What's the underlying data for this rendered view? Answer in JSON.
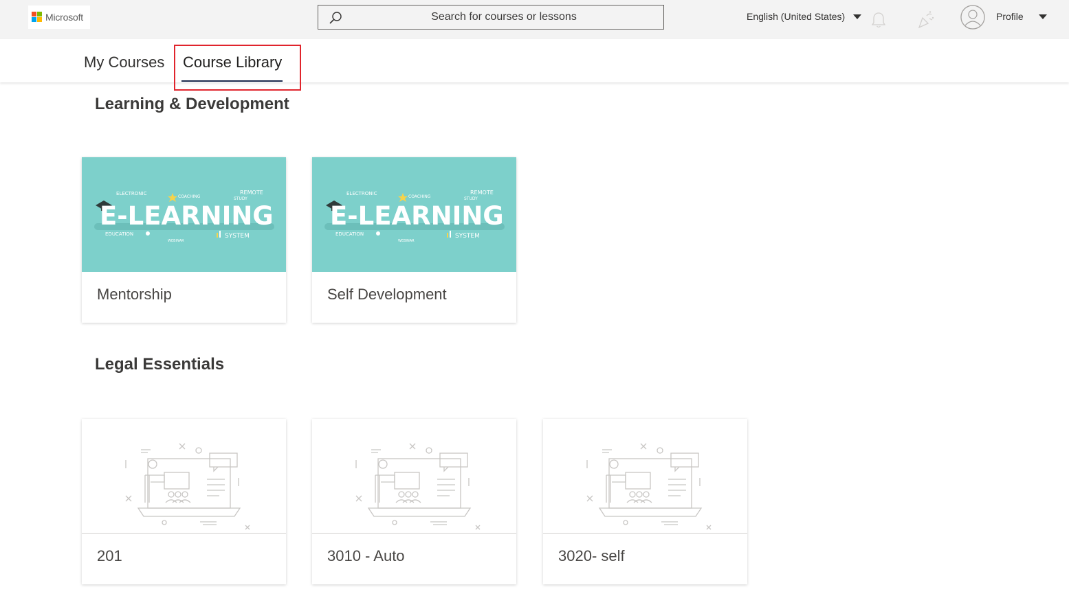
{
  "header": {
    "logo_text": "Microsoft",
    "search": {
      "placeholder": "Search for courses or lessons"
    },
    "language": "English (United States)",
    "profile_label": "Profile"
  },
  "tabs": [
    {
      "label": "My Courses",
      "selected": false
    },
    {
      "label": "Course Library",
      "selected": true
    }
  ],
  "sections": [
    {
      "title": "Learning & Development",
      "courses": [
        {
          "title": "Mentorship",
          "image": "e-learning-banner"
        },
        {
          "title": "Self Development",
          "image": "e-learning-banner"
        }
      ]
    },
    {
      "title": "Legal Essentials",
      "courses": [
        {
          "title": "201",
          "image": "course-placeholder"
        },
        {
          "title": "3010 - Auto",
          "image": "course-placeholder"
        },
        {
          "title": "3020- self",
          "image": "course-placeholder"
        }
      ]
    }
  ],
  "banner_text": {
    "main": "E-LEARNING",
    "words": [
      "ELECTRONIC",
      "COACHING",
      "REMOTE",
      "STUDY",
      "EDUCATION",
      "WEBINAR",
      "SYSTEM"
    ]
  },
  "colors": {
    "banner_bg": "#7dd0cb",
    "tab_underline": "#1b2a4e",
    "highlight": "#e0242c"
  }
}
